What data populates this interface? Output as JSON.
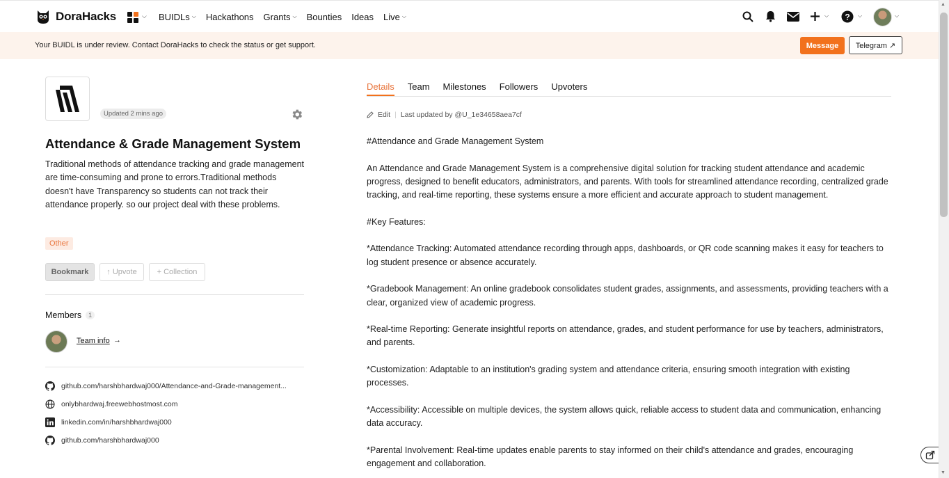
{
  "brand": {
    "name": "DoraHacks"
  },
  "nav": {
    "items": [
      {
        "label": "BUIDLs",
        "has_caret": true
      },
      {
        "label": "Hackathons",
        "has_caret": false
      },
      {
        "label": "Grants",
        "has_caret": true
      },
      {
        "label": "Bounties",
        "has_caret": false
      },
      {
        "label": "Ideas",
        "has_caret": false
      },
      {
        "label": "Live",
        "has_caret": true
      }
    ],
    "right_icons": [
      "search-icon",
      "bell-icon",
      "mail-icon",
      "plus-icon",
      "help-icon",
      "avatar"
    ]
  },
  "banner": {
    "text": "Your BUIDL is under review. Contact DoraHacks to check the status or get support.",
    "message_label": "Message",
    "telegram_label": "Telegram ↗"
  },
  "project": {
    "updated": "Updated 2 mins ago",
    "title": "Attendance & Grade Management System",
    "description": "Traditional methods of attendance tracking and grade management are time-consuming and prone to errors.Traditional methods doesn't have Transparency so students can not track their attendance properly. so our project deal with these problems.",
    "tag": "Other",
    "bookmark_label": "Bookmark",
    "upvote_label": "↑ Upvote",
    "collection_label": "+ Collection"
  },
  "members": {
    "title": "Members",
    "count": "1",
    "team_info_label": "Team info",
    "team_info_arrow": "→"
  },
  "links": [
    {
      "icon": "github-icon",
      "text": "github.com/harshbhardwaj000/Attendance-and-Grade-management..."
    },
    {
      "icon": "globe-icon",
      "text": "onlybhardwaj.freewebhostmost.com"
    },
    {
      "icon": "linkedin-icon",
      "text": "linkedin.com/in/harshbhardwaj000"
    },
    {
      "icon": "github-icon",
      "text": "github.com/harshbhardwaj000"
    }
  ],
  "tabs": [
    {
      "label": "Details",
      "active": true
    },
    {
      "label": "Team",
      "active": false
    },
    {
      "label": "Milestones",
      "active": false
    },
    {
      "label": "Followers",
      "active": false
    },
    {
      "label": "Upvoters",
      "active": false
    }
  ],
  "edit_row": {
    "edit_label": "Edit",
    "separator": "|",
    "last_updated": "Last updated by @U_1e34658aea7cf"
  },
  "details": {
    "paragraphs": [
      "#Attendance and Grade Management System",
      "An Attendance and Grade Management System is a comprehensive digital solution for tracking student attendance and academic progress, designed to benefit educators, administrators, and parents. With tools for streamlined attendance recording, centralized grade tracking, and real-time reporting, these systems ensure a more efficient and accurate approach to student management.",
      "#Key Features:",
      "*Attendance Tracking: Automated attendance recording through apps, dashboards, or QR code scanning makes it easy for teachers to log student presence or absence accurately.",
      "*Gradebook Management: An online gradebook consolidates student grades, assignments, and assessments, providing teachers with a clear, organized view of academic progress.",
      "*Real-time Reporting: Generate insightful reports on attendance, grades, and student performance for use by teachers, administrators, and parents.",
      "*Customization: Adaptable to an institution's grading system and attendance criteria, ensuring smooth integration with existing processes.",
      "*Accessibility: Accessible on multiple devices, the system allows quick, reliable access to student data and communication, enhancing data accuracy.",
      "*Parental Involvement: Real-time updates enable parents to stay informed on their child's attendance and grades, encouraging engagement and collaboration."
    ]
  },
  "colors": {
    "accent": "#f2711c",
    "banner_bg": "#fdf3ec",
    "tag_text": "#e8743b"
  }
}
